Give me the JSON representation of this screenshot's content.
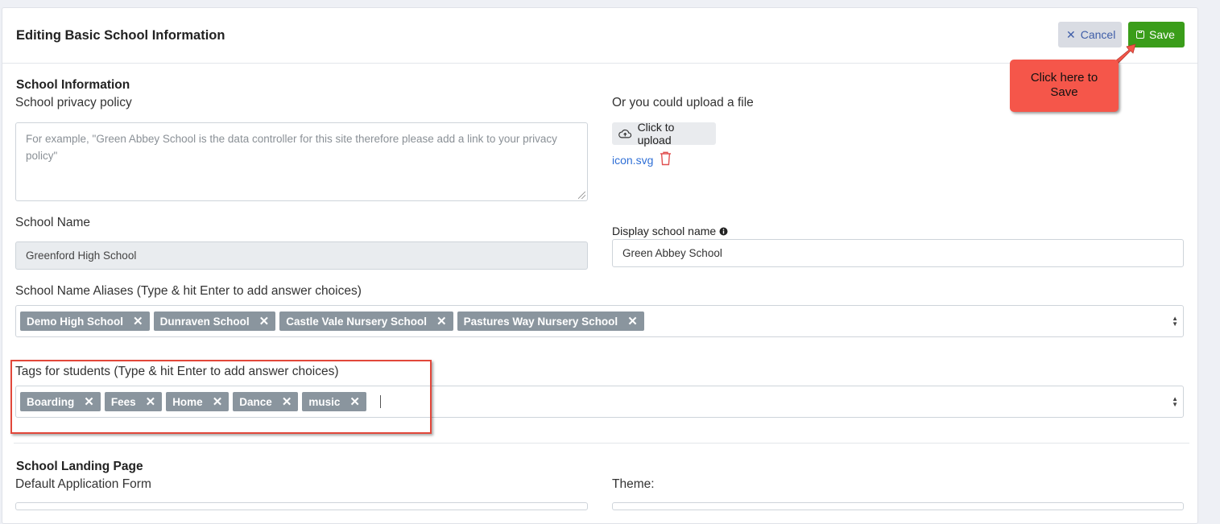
{
  "header": {
    "title": "Editing Basic School Information",
    "cancel_label": "Cancel",
    "save_label": "Save",
    "cancel_icon": "close-icon",
    "save_icon": "floppy-disk-icon"
  },
  "school_info": {
    "section_title": "School Information",
    "privacy_label": "School privacy policy",
    "privacy_placeholder": "For example, \"Green Abbey School is the data controller for this site therefore please add a link to your privacy policy\"",
    "upload_label": "Or you could upload a file",
    "upload_button": "Click to upload",
    "upload_icon": "cloud-upload-icon",
    "file_name": "icon.svg",
    "delete_icon": "trash-icon",
    "school_name_label": "School Name",
    "school_name_value": "Greenford High School",
    "display_name_label": "Display school name",
    "display_name_value": "Green Abbey School",
    "aliases_label": "School Name Aliases (Type & hit Enter to add answer choices)",
    "aliases": [
      "Demo High School",
      "Dunraven School",
      "Castle Vale Nursery School",
      "Pastures Way Nursery School"
    ],
    "tags_label": "Tags for students (Type & hit Enter to add answer choices)",
    "tags": [
      "Boarding",
      "Fees",
      "Home",
      "Dance",
      "music"
    ]
  },
  "landing": {
    "section_title": "School Landing Page",
    "default_form_label": "Default Application Form",
    "theme_label": "Theme:"
  },
  "annotation": {
    "callout_text": "Click here to Save",
    "color": "#f5564a"
  },
  "colors": {
    "save": "#3a9d1a",
    "cancel_bg": "#d9dce3",
    "tag_bg": "#8a959e",
    "highlight": "#e2473a"
  }
}
